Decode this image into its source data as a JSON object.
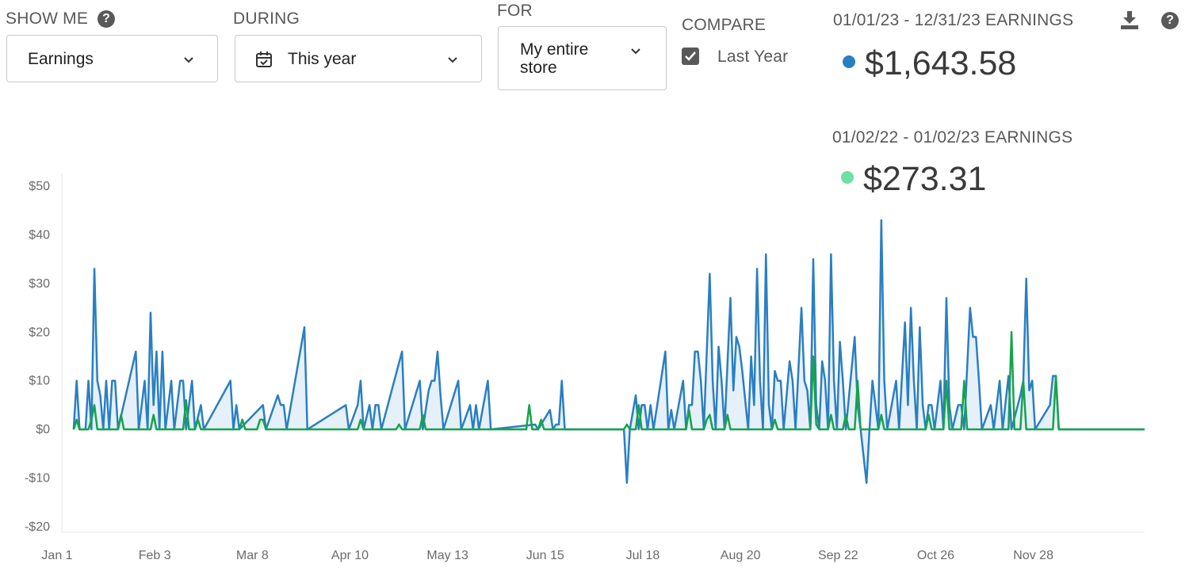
{
  "controls": {
    "show_me": {
      "label": "SHOW ME",
      "value": "Earnings"
    },
    "during": {
      "label": "DURING",
      "value": "This year"
    },
    "for": {
      "label": "FOR",
      "value_line1": "My entire",
      "value_line2": "store"
    },
    "compare": {
      "label": "COMPARE",
      "option": "Last Year",
      "checked": true
    }
  },
  "stats": {
    "current": {
      "title": "01/01/23 - 12/31/23 EARNINGS",
      "value": "$1,643.58",
      "color": "#2a7fc1"
    },
    "previous": {
      "title": "01/02/22 - 01/02/23 EARNINGS",
      "value": "$273.31",
      "color": "#6ee0a3"
    }
  },
  "icons": {
    "download": "download-icon",
    "help": "help-icon"
  },
  "chart_data": {
    "type": "line",
    "x_labels": [
      "Jan 1",
      "Feb 3",
      "Mar 8",
      "Apr 10",
      "May 13",
      "Jun 15",
      "Jul 18",
      "Aug 20",
      "Sep 22",
      "Oct 26",
      "Nov 28"
    ],
    "y_ticks": [
      "$50",
      "$40",
      "$30",
      "$20",
      "$10",
      "$0",
      "-$10",
      "-$20"
    ],
    "ylim": [
      -20,
      50
    ],
    "days": 366,
    "series": [
      {
        "key": "this_year",
        "color": "#2a7fc1",
        "fill": "#e6f0f9",
        "points": [
          [
            4,
            0
          ],
          [
            5,
            10
          ],
          [
            6,
            0
          ],
          [
            8,
            0
          ],
          [
            9,
            10
          ],
          [
            10,
            0
          ],
          [
            11,
            33
          ],
          [
            12,
            10
          ],
          [
            13,
            7
          ],
          [
            14,
            0
          ],
          [
            15,
            10
          ],
          [
            16,
            0
          ],
          [
            17,
            10
          ],
          [
            18,
            10
          ],
          [
            19,
            0
          ],
          [
            25,
            16
          ],
          [
            26,
            0
          ],
          [
            28,
            10
          ],
          [
            29,
            0
          ],
          [
            30,
            24
          ],
          [
            31,
            5
          ],
          [
            32,
            16
          ],
          [
            33,
            0
          ],
          [
            34,
            16
          ],
          [
            35,
            0
          ],
          [
            37,
            10
          ],
          [
            38,
            0
          ],
          [
            40,
            10
          ],
          [
            41,
            10
          ],
          [
            42,
            0
          ],
          [
            44,
            10
          ],
          [
            45,
            0
          ],
          [
            47,
            5
          ],
          [
            48,
            0
          ],
          [
            57,
            10
          ],
          [
            58,
            0
          ],
          [
            59,
            5
          ],
          [
            60,
            0
          ],
          [
            68,
            5
          ],
          [
            69,
            0
          ],
          [
            73,
            7
          ],
          [
            74,
            5
          ],
          [
            75,
            5
          ],
          [
            76,
            0
          ],
          [
            82,
            21
          ],
          [
            83,
            0
          ],
          [
            96,
            5
          ],
          [
            97,
            0
          ],
          [
            100,
            5
          ],
          [
            101,
            10
          ],
          [
            102,
            0
          ],
          [
            104,
            5
          ],
          [
            105,
            0
          ],
          [
            106,
            5
          ],
          [
            107,
            5
          ],
          [
            108,
            0
          ],
          [
            115,
            16
          ],
          [
            116,
            0
          ],
          [
            121,
            10
          ],
          [
            122,
            0
          ],
          [
            124,
            8
          ],
          [
            125,
            10
          ],
          [
            126,
            10
          ],
          [
            127,
            16
          ],
          [
            128,
            7
          ],
          [
            129,
            0
          ],
          [
            134,
            10
          ],
          [
            135,
            0
          ],
          [
            138,
            5
          ],
          [
            139,
            0
          ],
          [
            140,
            5
          ],
          [
            141,
            0
          ],
          [
            144,
            10
          ],
          [
            145,
            0
          ],
          [
            160,
            1
          ],
          [
            161,
            0
          ],
          [
            165,
            4
          ],
          [
            166,
            0
          ],
          [
            167,
            1
          ],
          [
            168,
            1
          ],
          [
            169,
            10
          ],
          [
            170,
            0
          ],
          [
            190,
            0
          ],
          [
            191,
            -11
          ],
          [
            192,
            0
          ],
          [
            194,
            7
          ],
          [
            195,
            0
          ],
          [
            196,
            5
          ],
          [
            197,
            5
          ],
          [
            198,
            0
          ],
          [
            199,
            5
          ],
          [
            200,
            0
          ],
          [
            204,
            16
          ],
          [
            205,
            0
          ],
          [
            206,
            4
          ],
          [
            207,
            0
          ],
          [
            210,
            10
          ],
          [
            211,
            0
          ],
          [
            212,
            5
          ],
          [
            213,
            5
          ],
          [
            214,
            16
          ],
          [
            215,
            16
          ],
          [
            216,
            10
          ],
          [
            217,
            0
          ],
          [
            219,
            32
          ],
          [
            220,
            10
          ],
          [
            221,
            0
          ],
          [
            222,
            17
          ],
          [
            223,
            10
          ],
          [
            224,
            0
          ],
          [
            226,
            27
          ],
          [
            227,
            8
          ],
          [
            228,
            19
          ],
          [
            229,
            17
          ],
          [
            230,
            12
          ],
          [
            231,
            6
          ],
          [
            232,
            0
          ],
          [
            233,
            15
          ],
          [
            234,
            5
          ],
          [
            235,
            33
          ],
          [
            236,
            10
          ],
          [
            237,
            0
          ],
          [
            238,
            36
          ],
          [
            239,
            5
          ],
          [
            240,
            0
          ],
          [
            241,
            12
          ],
          [
            242,
            10
          ],
          [
            243,
            10
          ],
          [
            244,
            0
          ],
          [
            246,
            14
          ],
          [
            247,
            10
          ],
          [
            248,
            0
          ],
          [
            250,
            25
          ],
          [
            251,
            10
          ],
          [
            252,
            8
          ],
          [
            253,
            0
          ],
          [
            254,
            35
          ],
          [
            255,
            5
          ],
          [
            256,
            0
          ],
          [
            257,
            14
          ],
          [
            258,
            10
          ],
          [
            259,
            0
          ],
          [
            260,
            36
          ],
          [
            261,
            10
          ],
          [
            262,
            0
          ],
          [
            263,
            18
          ],
          [
            264,
            10
          ],
          [
            265,
            0
          ],
          [
            268,
            19
          ],
          [
            269,
            5
          ],
          [
            270,
            0
          ],
          [
            272,
            -11
          ],
          [
            273,
            0
          ],
          [
            274,
            10
          ],
          [
            275,
            5
          ],
          [
            276,
            0
          ],
          [
            277,
            43
          ],
          [
            278,
            10
          ],
          [
            279,
            0
          ],
          [
            282,
            10
          ],
          [
            283,
            0
          ],
          [
            285,
            22
          ],
          [
            286,
            5
          ],
          [
            287,
            25
          ],
          [
            288,
            10
          ],
          [
            289,
            0
          ],
          [
            290,
            21
          ],
          [
            291,
            5
          ],
          [
            292,
            0
          ],
          [
            293,
            5
          ],
          [
            294,
            5
          ],
          [
            295,
            0
          ],
          [
            297,
            10
          ],
          [
            298,
            0
          ],
          [
            299,
            27
          ],
          [
            300,
            5
          ],
          [
            301,
            0
          ],
          [
            303,
            5
          ],
          [
            304,
            5
          ],
          [
            305,
            0
          ],
          [
            307,
            25
          ],
          [
            308,
            19
          ],
          [
            309,
            19
          ],
          [
            310,
            10
          ],
          [
            311,
            0
          ],
          [
            314,
            5
          ],
          [
            315,
            0
          ],
          [
            317,
            10
          ],
          [
            318,
            0
          ],
          [
            320,
            11
          ],
          [
            321,
            0
          ],
          [
            324,
            7
          ],
          [
            325,
            10
          ],
          [
            326,
            31
          ],
          [
            327,
            8
          ],
          [
            328,
            10
          ],
          [
            329,
            0
          ],
          [
            334,
            5
          ],
          [
            335,
            11
          ],
          [
            336,
            11
          ],
          [
            337,
            0
          ],
          [
            366,
            0
          ]
        ]
      },
      {
        "key": "last_year",
        "color": "#16a34a",
        "points": [
          [
            4,
            0
          ],
          [
            5,
            2
          ],
          [
            6,
            0
          ],
          [
            8,
            0
          ],
          [
            9,
            0
          ],
          [
            10,
            2
          ],
          [
            11,
            5
          ],
          [
            12,
            0
          ],
          [
            19,
            0
          ],
          [
            20,
            3
          ],
          [
            21,
            0
          ],
          [
            30,
            0
          ],
          [
            31,
            3
          ],
          [
            32,
            0
          ],
          [
            41,
            0
          ],
          [
            42,
            6
          ],
          [
            43,
            0
          ],
          [
            45,
            0
          ],
          [
            46,
            2
          ],
          [
            47,
            0
          ],
          [
            60,
            0
          ],
          [
            61,
            2
          ],
          [
            62,
            0
          ],
          [
            66,
            0
          ],
          [
            67,
            2
          ],
          [
            68,
            2
          ],
          [
            69,
            0
          ],
          [
            100,
            0
          ],
          [
            101,
            2
          ],
          [
            102,
            0
          ],
          [
            113,
            0
          ],
          [
            114,
            1
          ],
          [
            115,
            0
          ],
          [
            121,
            0
          ],
          [
            122,
            3
          ],
          [
            123,
            0
          ],
          [
            157,
            0
          ],
          [
            158,
            5
          ],
          [
            159,
            0
          ],
          [
            161,
            0
          ],
          [
            162,
            2
          ],
          [
            163,
            0
          ],
          [
            190,
            0
          ],
          [
            191,
            1
          ],
          [
            192,
            0
          ],
          [
            194,
            0
          ],
          [
            195,
            5
          ],
          [
            196,
            0
          ],
          [
            211,
            0
          ],
          [
            212,
            4
          ],
          [
            213,
            0
          ],
          [
            217,
            0
          ],
          [
            218,
            2
          ],
          [
            219,
            3
          ],
          [
            220,
            0
          ],
          [
            224,
            0
          ],
          [
            225,
            3
          ],
          [
            226,
            0
          ],
          [
            240,
            0
          ],
          [
            241,
            2
          ],
          [
            242,
            0
          ],
          [
            253,
            0
          ],
          [
            254,
            15
          ],
          [
            255,
            1
          ],
          [
            256,
            0
          ],
          [
            259,
            0
          ],
          [
            260,
            3
          ],
          [
            261,
            0
          ],
          [
            264,
            0
          ],
          [
            265,
            3
          ],
          [
            266,
            0
          ],
          [
            268,
            0
          ],
          [
            269,
            10
          ],
          [
            270,
            0
          ],
          [
            276,
            0
          ],
          [
            277,
            3
          ],
          [
            278,
            0
          ],
          [
            292,
            0
          ],
          [
            293,
            3
          ],
          [
            294,
            0
          ],
          [
            298,
            0
          ],
          [
            299,
            10
          ],
          [
            300,
            0
          ],
          [
            304,
            0
          ],
          [
            305,
            10
          ],
          [
            306,
            0
          ],
          [
            320,
            0
          ],
          [
            321,
            20
          ],
          [
            322,
            0
          ],
          [
            324,
            0
          ],
          [
            325,
            10
          ],
          [
            326,
            0
          ],
          [
            335,
            0
          ],
          [
            336,
            11
          ],
          [
            337,
            0
          ],
          [
            366,
            0
          ]
        ]
      }
    ]
  }
}
